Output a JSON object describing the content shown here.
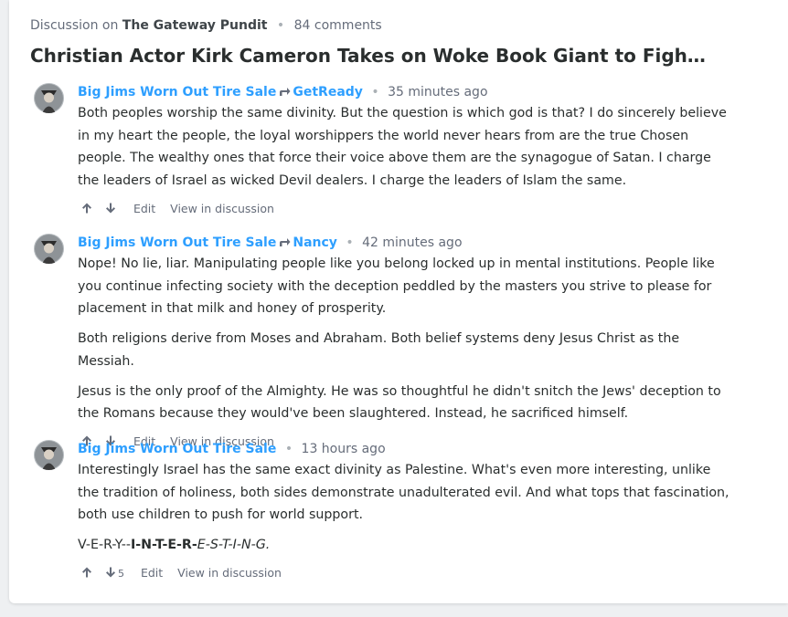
{
  "header": {
    "prefix": "Discussion on",
    "site": "The Gateway Pundit",
    "comment_count": "84 comments"
  },
  "title": "Christian Actor Kirk Cameron Takes on Woke Book Giant to Fight Harmful,...",
  "actions": {
    "edit": "Edit",
    "view": "View in discussion"
  },
  "comments": [
    {
      "author": "Big Jims Worn Out Tire Sale",
      "reply_to": "GetReady",
      "time": "35 minutes ago",
      "paragraphs": [
        "Both peoples worship the same divinity. But the question is which god is that? I do sincerely believe in my heart the people, the loyal worshippers the world never hears from are the true Chosen people. The wealthy ones that force their voice above them are the synagogue of Satan. I charge the leaders of Israel as wicked Devil dealers. I charge the leaders of Islam the same."
      ]
    },
    {
      "author": "Big Jims Worn Out Tire Sale",
      "reply_to": "Nancy",
      "time": "42 minutes ago",
      "paragraphs": [
        "Nope! No lie, liar. Manipulating people like you belong locked up in mental institutions. People like you continue infecting society with the deception peddled by the masters you strive to please for placement in that milk and honey of prosperity.",
        "Both religions derive from Moses and Abraham. Both belief systems deny Jesus Christ as the Messiah.",
        "Jesus is the only proof of the Almighty. He was so thoughtful he didn't snitch the Jews' deception to the Romans because they would've been slaughtered. Instead, he sacrificed himself."
      ]
    },
    {
      "author": "Big Jims Worn Out Tire Sale",
      "time": "13 hours ago",
      "downvotes": "5",
      "paragraphs": [
        "Interestingly Israel has the same exact divinity as Palestine. What's even more interesting, unlike the tradition of holiness, both sides demonstrate unadulterated evil. And what tops that fascination, both use children to push for world support."
      ],
      "styled_line": {
        "part1": "V-E-R-Y--",
        "part2": "I-N-T-E-R-",
        "part3": "E-S-T-I-N-G."
      }
    }
  ],
  "colors": {
    "link": "#2e9fff",
    "text": "#2a2e2e",
    "muted": "#656c7a",
    "background": "#eef0f2"
  },
  "icons": [
    "avatar",
    "reply-arrow-icon",
    "upvote-icon",
    "downvote-icon"
  ]
}
